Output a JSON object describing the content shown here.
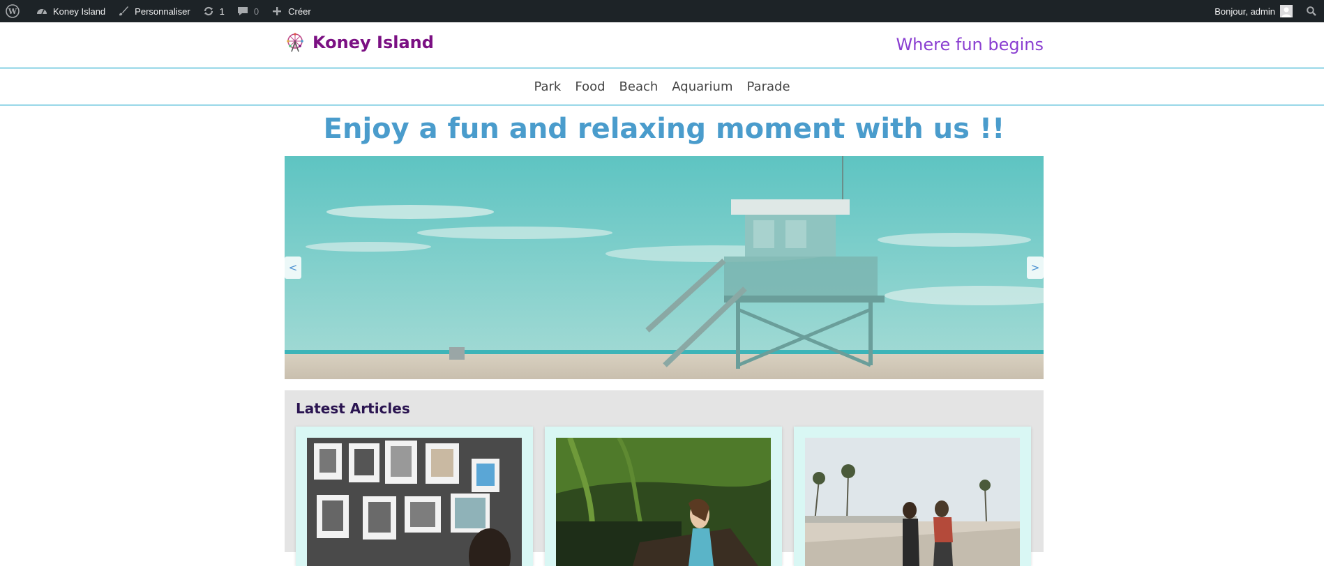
{
  "admin_bar": {
    "site_name": "Koney Island",
    "customize": "Personnaliser",
    "updates": "1",
    "comments": "0",
    "new": "Créer",
    "greeting": "Bonjour, admin"
  },
  "header": {
    "site_title": "Koney Island",
    "tagline": "Where fun begins"
  },
  "nav": {
    "items": [
      "Park",
      "Food",
      "Beach",
      "Aquarium",
      "Parade"
    ]
  },
  "hero": {
    "title": "Enjoy a fun and relaxing moment with us !!",
    "prev": "<",
    "next": ">"
  },
  "articles": {
    "title": "Latest Articles"
  },
  "colors": {
    "admin_bar": "#1d2327",
    "brand": "#7b1083",
    "tagline": "#8a3fd1",
    "hero_title": "#4a9ccc",
    "card_bg": "#d9f7f4"
  }
}
